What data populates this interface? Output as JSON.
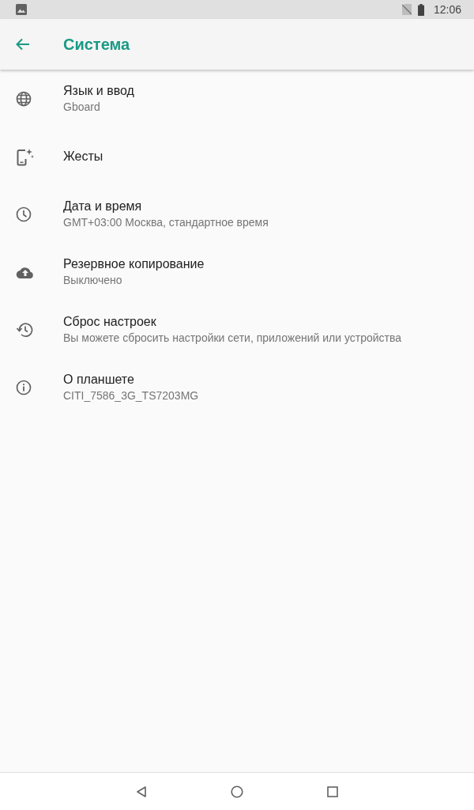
{
  "status_bar": {
    "time": "12:06"
  },
  "app_bar": {
    "title": "Система"
  },
  "items": [
    {
      "kind": "globe",
      "title": "Язык и ввод",
      "summary": "Gboard"
    },
    {
      "kind": "gestures",
      "title": "Жесты"
    },
    {
      "kind": "clock",
      "title": "Дата и время",
      "summary": "GMT+03:00 Москва, стандартное время"
    },
    {
      "kind": "cloud",
      "title": "Резервное копирование",
      "summary": "Выключено"
    },
    {
      "kind": "restore",
      "title": "Сброс настроек",
      "summary": "Вы можете сбросить настройки сети, приложений или устройства"
    },
    {
      "kind": "info",
      "title": "О планшете",
      "summary": "CITI_7586_3G_TS7203MG"
    }
  ]
}
